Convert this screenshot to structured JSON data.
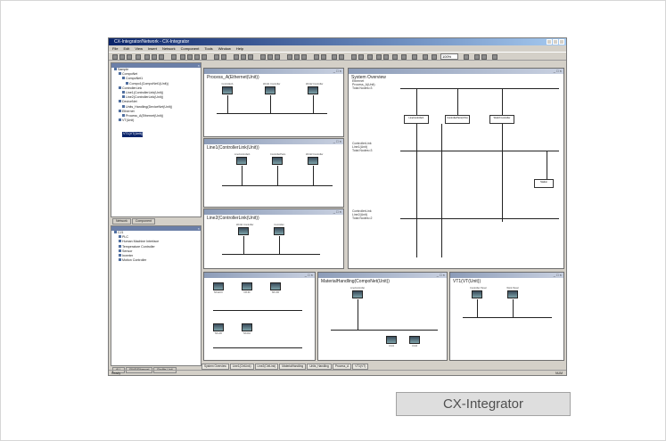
{
  "caption": "CX-Integrator",
  "app": {
    "title": "CX-Integrator/Network - CX-Integrator",
    "menu": [
      "File",
      "Edit",
      "View",
      "Insert",
      "Network",
      "Component",
      "Tools",
      "Window",
      "Help"
    ],
    "zoom": "100%",
    "status": "Ready",
    "status_right": "NUM"
  },
  "workspace": {
    "tree": [
      "Sample",
      "CompoNet",
      "CompoNet1",
      "Compo1(CompoNet1(Unit))",
      "ControllerLink",
      "Line1(ControllerLink(Unit))",
      "Line2(ControllerLink(Unit))",
      "DeviceNet",
      "Units_Handling(DeviceNet(Unit))",
      "Ethernet",
      "Process_A(Ethernet(Unit))",
      "VT(Unit)",
      "VT1(VT(Unit))"
    ],
    "tabs": [
      "Network",
      "Component"
    ]
  },
  "components": {
    "tree": [
      "CJ1",
      "PLC",
      "Human Machine Interface",
      "Temperature Controller",
      "Sensor",
      "Inverter",
      "Motion Controller"
    ],
    "tabs": [
      "ALL",
      "FINS/Ethernet",
      "Profile Unit"
    ]
  },
  "windows": {
    "ethernet": "Process_A(Ethernet(Unit))",
    "line1": "Line1(ControllerLink(Unit))",
    "line2": "Line2(ControllerLink(Unit))",
    "overview": "System Overview",
    "compo": "MaterialHandling(CompoNet(Unit))",
    "vt": "VT1(VT(Unit))",
    "overview_nets": [
      "Ethernet",
      "ControllerLink",
      "ControllerLink"
    ],
    "overview_sub": [
      "Process_A(Unit)",
      "Line1(Unit)",
      "Line2(Unit)"
    ],
    "overview_total": [
      "Total Nodes=3",
      "Total Nodes=3",
      "Total Nodes=2"
    ],
    "overview_nodes": [
      "LineController1",
      "ControllerParts(CS1)",
      "Work3 Controller",
      "Station"
    ],
    "devices": {
      "eth": [
        "ControllerA",
        "Work1 Controller",
        "Work2 Controller"
      ],
      "line1": [
        "LineController1",
        "ControllerParts",
        "Work3 Controller"
      ],
      "line2": [
        "Work1 Controller",
        "Controller"
      ],
      "compo": [
        "NX-ECC",
        "NX-ID",
        "NX-OD",
        "NX-AD",
        "NX-DA"
      ],
      "material": [
        "LineController",
        "Unit1",
        "Unit2"
      ],
      "vt": [
        "Controller Panel",
        "Work Panel"
      ]
    }
  },
  "bottom_tabs": [
    "System Overview",
    "Line1(CtrlLink)",
    "Line2(CtrlLink)",
    "MaterialHandling",
    "Units_Handling",
    "Process_A",
    "VT1(VT)"
  ]
}
